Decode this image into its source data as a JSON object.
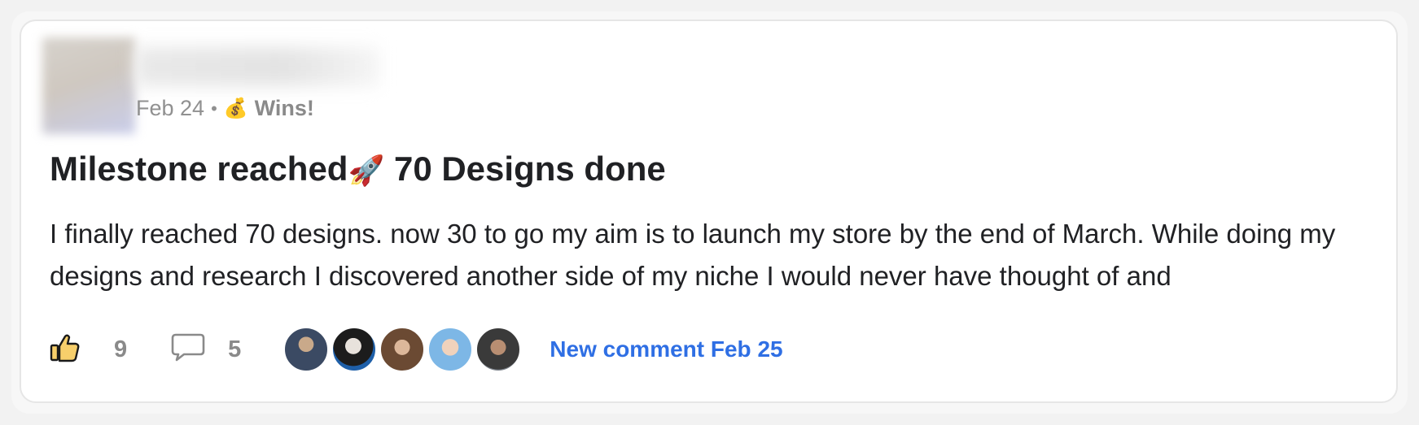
{
  "post": {
    "date": "Feb 24",
    "separator": "•",
    "category_emoji": "💰",
    "category": "Wins!",
    "title_start": "Milestone reached",
    "title_emoji": "🚀",
    "title_end": " 70 Designs done",
    "body": "I finally reached 70 designs. now 30 to go my aim is to launch my store by the end of March. While doing my designs and research I discovered another side of my niche I would never have thought of and"
  },
  "footer": {
    "likes": "9",
    "comments": "5",
    "new_comment": "New comment Feb 25",
    "like_icon": "thumbs-up-icon",
    "comment_icon": "speech-bubble-icon",
    "commenter_count": 5
  },
  "colors": {
    "accent": "#2f6fe4",
    "like_icon_fill": "#f7cf6b",
    "text": "#202124",
    "muted": "#909090"
  }
}
